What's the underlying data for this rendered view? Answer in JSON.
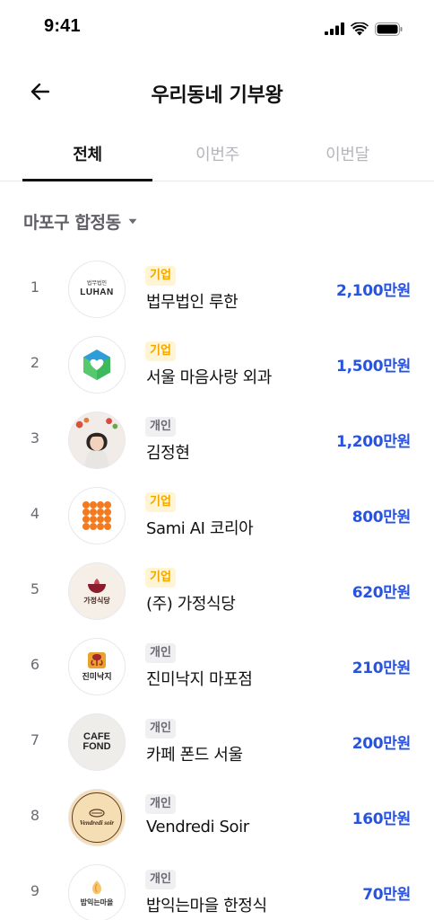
{
  "status_bar": {
    "time": "9:41"
  },
  "header": {
    "title": "우리동네 기부왕"
  },
  "tabs": [
    {
      "label": "전체",
      "active": true
    },
    {
      "label": "이번주",
      "active": false
    },
    {
      "label": "이번달",
      "active": false
    }
  ],
  "location": {
    "label": "마포구 합정동"
  },
  "colors": {
    "amount": "#2753e0",
    "badge_corp_text": "#f2a600",
    "badge_corp_bg": "#fff4d3",
    "badge_indiv_text": "#6a6a72",
    "badge_indiv_bg": "#f0f0f3"
  },
  "ranking": [
    {
      "rank": "1",
      "type": "기업",
      "name": "법무법인 루한",
      "amount": "2,100만원",
      "logo": {
        "icon": "luhan-logo",
        "line1": "법무법인",
        "line2": "LUHAN"
      }
    },
    {
      "rank": "2",
      "type": "기업",
      "name": "서울 마음사랑 외과",
      "amount": "1,500만원",
      "logo": {
        "icon": "hexagon-heart-logo"
      }
    },
    {
      "rank": "3",
      "type": "개인",
      "name": "김정현",
      "amount": "1,200만원",
      "logo": {
        "icon": "person-photo"
      }
    },
    {
      "rank": "4",
      "type": "기업",
      "name": "Sami AI 코리아",
      "amount": "800만원",
      "logo": {
        "icon": "dot-grid-logo"
      }
    },
    {
      "rank": "5",
      "type": "기업",
      "name": "(주) 가정식당",
      "amount": "620만원",
      "logo": {
        "icon": "bowl-logo",
        "text": "가정식당"
      }
    },
    {
      "rank": "6",
      "type": "개인",
      "name": "진미낙지 마포점",
      "amount": "210만원",
      "logo": {
        "icon": "octopus-logo",
        "text": "진미낙지"
      }
    },
    {
      "rank": "7",
      "type": "개인",
      "name": "카페 폰드 서울",
      "amount": "200만원",
      "logo": {
        "icon": "cafe-fond-logo",
        "line1": "CAFE",
        "line2": "FOND"
      }
    },
    {
      "rank": "8",
      "type": "개인",
      "name": "Vendredi Soir",
      "amount": "160만원",
      "logo": {
        "icon": "vendredi-soir-logo",
        "text": "Vendredi soir"
      }
    },
    {
      "rank": "9",
      "type": "개인",
      "name": "밥익는마을 한정식",
      "amount": "70만원",
      "logo": {
        "icon": "rice-village-logo",
        "text": "밥익는마을"
      }
    }
  ]
}
